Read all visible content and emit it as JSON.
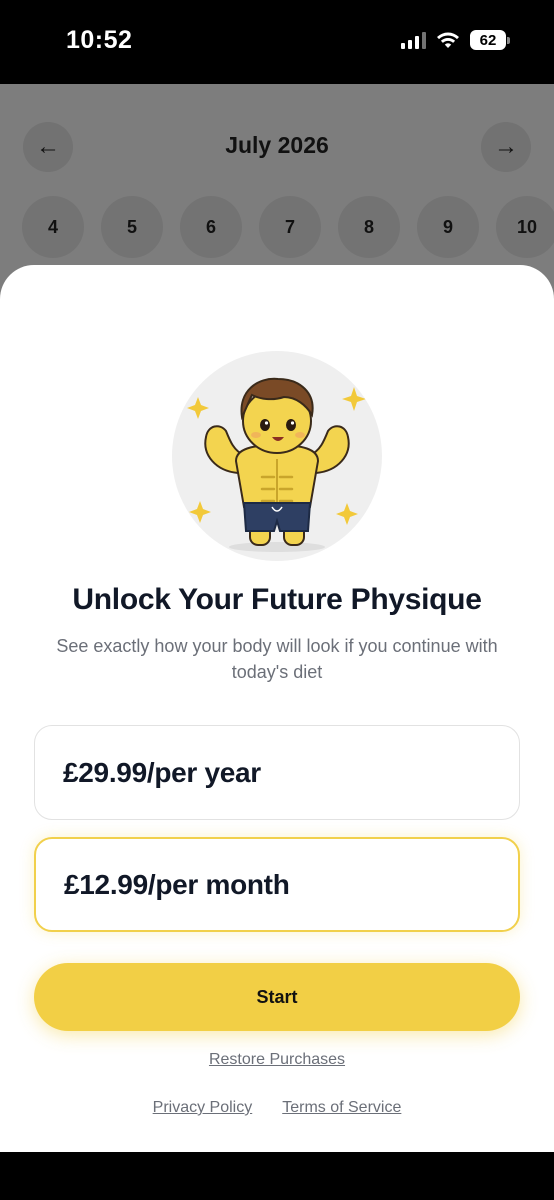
{
  "status_bar": {
    "time": "10:52",
    "battery": "62",
    "icons": [
      "signal-icon",
      "wifi-icon",
      "battery-icon"
    ]
  },
  "calendar": {
    "month": "July 2026",
    "prev_icon": "arrow-left-icon",
    "next_icon": "arrow-right-icon",
    "days": [
      "4",
      "5",
      "6",
      "7",
      "8",
      "9",
      "10"
    ]
  },
  "paywall": {
    "hero_icon": "muscular-mascot-illustration",
    "title": "Unlock Your Future Physique",
    "subtitle": "See exactly how your body will look if you continue with today's diet",
    "plans": [
      {
        "price": "£29.99/per year",
        "selected": false
      },
      {
        "price": "£12.99/per month",
        "selected": true
      }
    ],
    "start_label": "Start",
    "restore_label": "Restore Purchases",
    "privacy_label": "Privacy Policy",
    "terms_label": "Terms of Service"
  },
  "colors": {
    "accent": "#f2cf45",
    "selected_border": "#f1d04c",
    "text_primary": "#111827",
    "text_secondary": "#6b6f78",
    "dim_overlay": "#7d7d7d"
  }
}
